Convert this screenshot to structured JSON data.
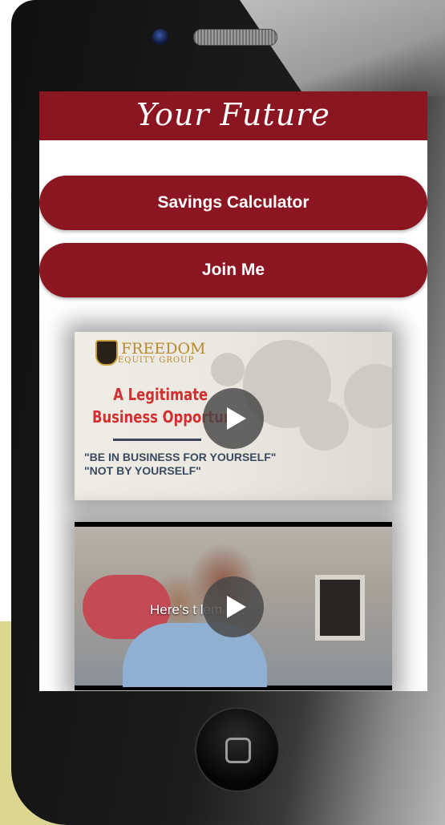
{
  "header": {
    "title": "Your Future"
  },
  "buttons": {
    "savings_calculator": "Savings Calculator",
    "join_me": "Join Me"
  },
  "videos": [
    {
      "logo_line1": "FREEDOM",
      "logo_line2": "EQUITY GROUP",
      "title_line1": "A Legitimate",
      "title_line2": "Business Opportun",
      "quote_line1": "\"BE IN BUSINESS FOR YOURSELF\"",
      "quote_line2": "\"NOT BY YOURSELF\"",
      "play_icon": "play-icon"
    },
    {
      "caption": "Here's t         lem . . .",
      "play_icon": "play-icon"
    }
  ],
  "colors": {
    "brand": "#8b1621",
    "title_red": "#d0302f",
    "logo_gold": "#b98a2c"
  }
}
